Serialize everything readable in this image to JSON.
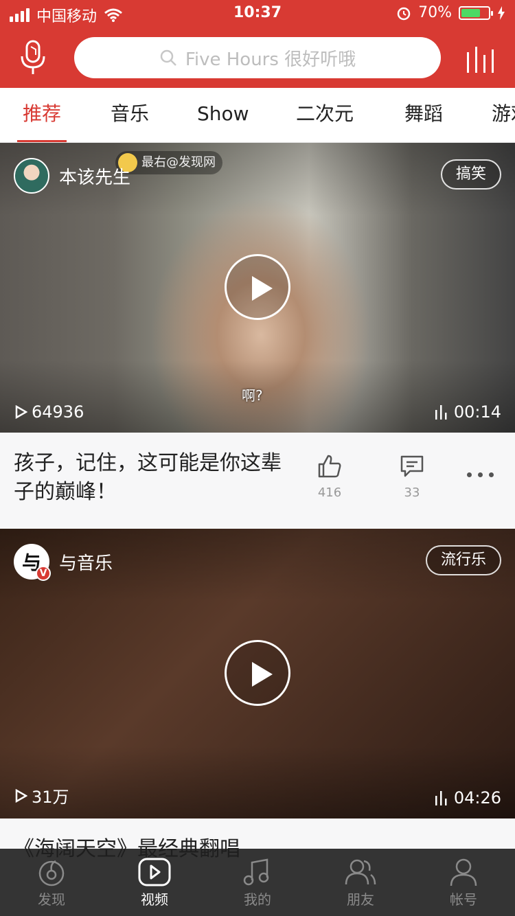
{
  "status_bar": {
    "carrier": "中国移动",
    "time": "10:37",
    "battery_percent": "70%",
    "battery_level": 0.7
  },
  "header": {
    "search_placeholder": "Five Hours 很好听哦"
  },
  "tabs": [
    {
      "label": "推荐",
      "active": true
    },
    {
      "label": "音乐",
      "active": false
    },
    {
      "label": "Show",
      "active": false
    },
    {
      "label": "二次元",
      "active": false
    },
    {
      "label": "舞蹈",
      "active": false
    },
    {
      "label": "游戏",
      "active": false
    }
  ],
  "videos": [
    {
      "author": "本该先生",
      "tag": "搞笑",
      "watermark": "最右@发现网",
      "subtitle": "啊?",
      "views": "64936",
      "duration": "00:14",
      "caption": "孩子，记住，这可能是你这辈子的巅峰！",
      "likes": "416",
      "comments": "33"
    },
    {
      "author": "与音乐",
      "avatar_text": "与",
      "verified_badge": "V",
      "tag": "流行乐",
      "views": "31万",
      "duration": "04:26",
      "caption": "《海阔天空》最经典翻唱"
    }
  ],
  "bottom_nav": [
    {
      "label": "发现",
      "icon": "discover-icon",
      "active": false
    },
    {
      "label": "视频",
      "icon": "video-icon",
      "active": true
    },
    {
      "label": "我的",
      "icon": "music-note-icon",
      "active": false
    },
    {
      "label": "朋友",
      "icon": "friends-icon",
      "active": false
    },
    {
      "label": "帐号",
      "icon": "account-icon",
      "active": false
    }
  ],
  "colors": {
    "brand_red": "#d83a33",
    "tab_active": "#d83a33"
  }
}
